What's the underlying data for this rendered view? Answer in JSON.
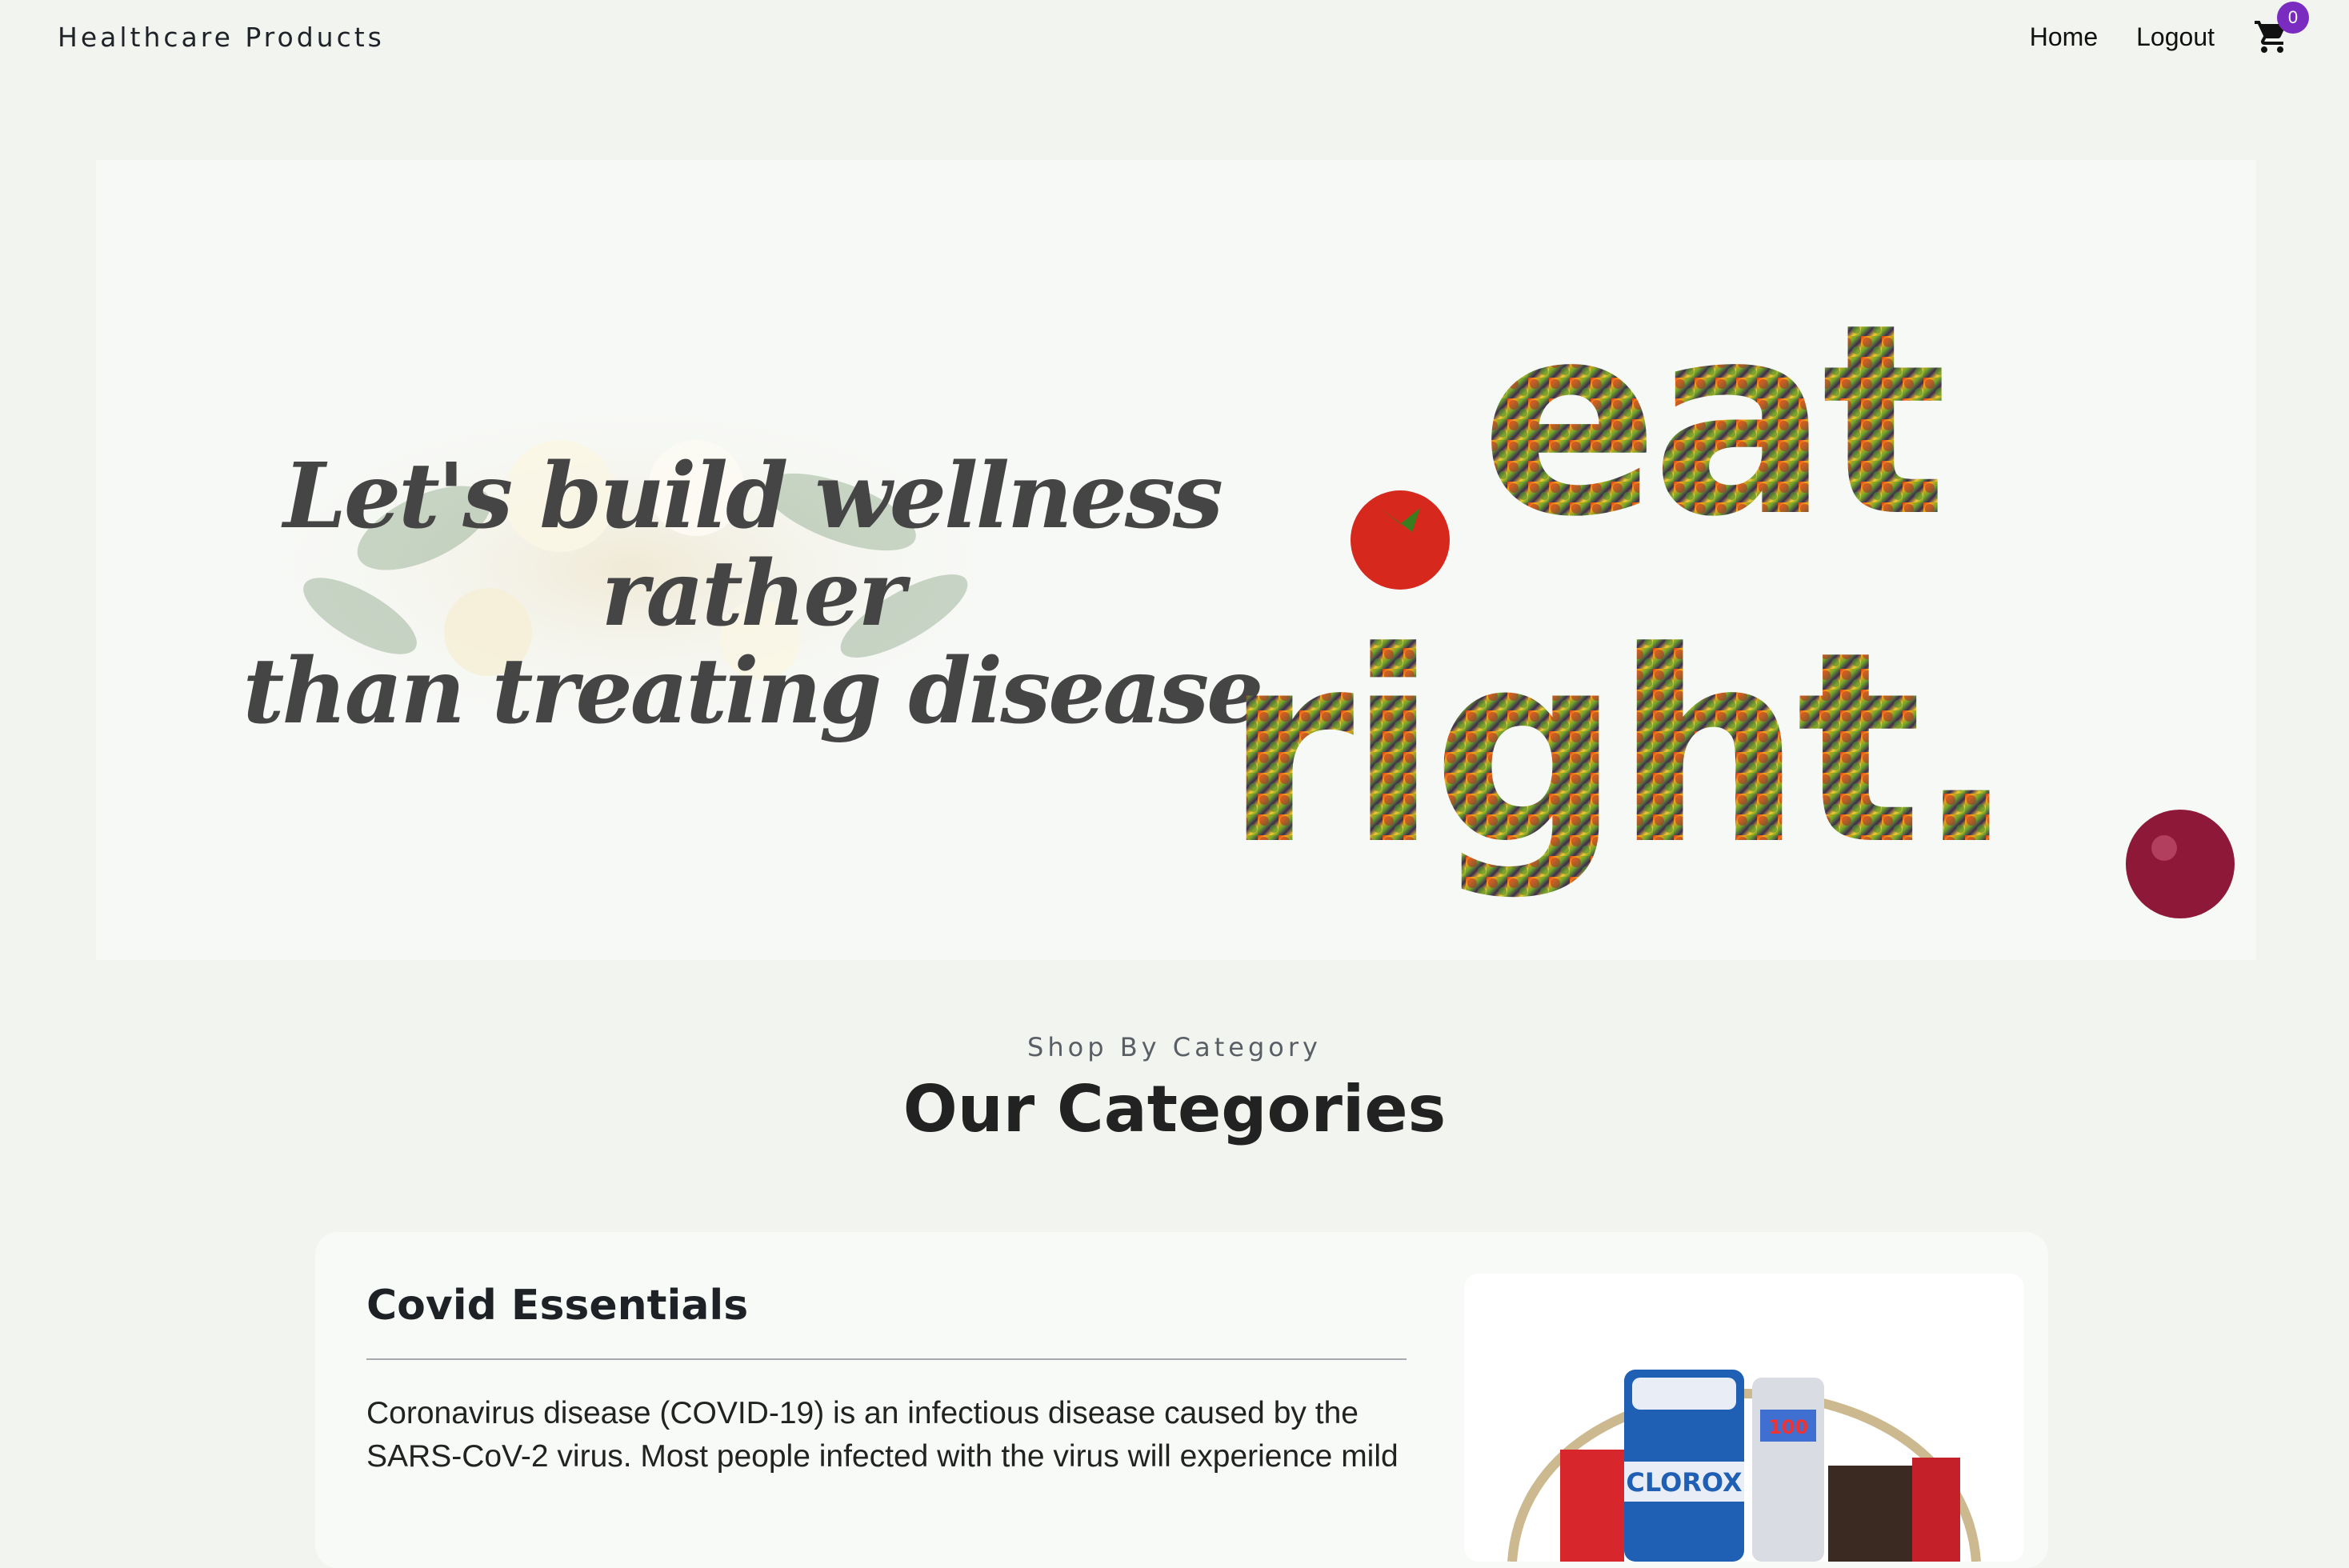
{
  "navbar": {
    "brand": "Healthcare Products",
    "links": {
      "home": "Home",
      "logout": "Logout"
    },
    "cart_count": "0"
  },
  "hero": {
    "tagline_line1": "Let's build wellness rather",
    "tagline_line2": "than treating disease",
    "image_text_line1": "eat",
    "image_text_line2": "right."
  },
  "categories": {
    "kicker": "Shop By Category",
    "title": "Our Categories",
    "items": [
      {
        "title": "Covid Essentials",
        "description": "Coronavirus disease (COVID-19) is an infectious disease caused by the SARS-CoV-2 virus. Most people infected with the virus will experience mild",
        "image_text": "CLOROX",
        "image_badge": "100"
      }
    ]
  },
  "colors": {
    "page_bg": "#f1f4ef",
    "badge": "#7a2bc0",
    "tagline": "#454545"
  },
  "icons": {
    "cart": "cart-icon"
  }
}
